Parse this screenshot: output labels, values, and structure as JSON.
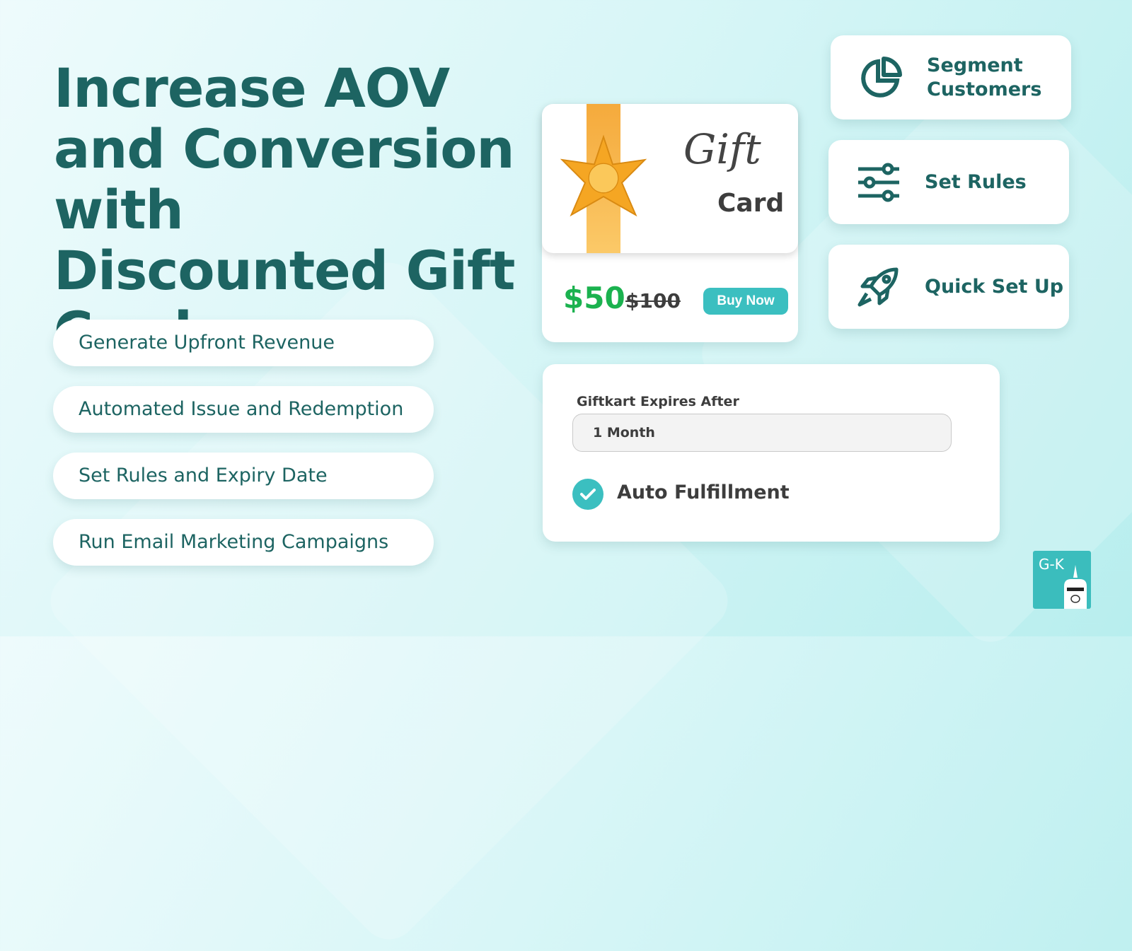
{
  "headline": "Increase AOV and Conversion with Discounted Gift Cards",
  "benefits": [
    "Generate Upfront Revenue",
    "Automated Issue and Redemption",
    "Set Rules and Expiry Date",
    "Run Email Marketing Campaigns"
  ],
  "gift_card": {
    "script_word": "Gift",
    "word": "Card",
    "price": "$50",
    "original_price": "$100",
    "buy_label": "Buy Now"
  },
  "features": [
    {
      "label": "Segment Customers",
      "icon": "pie-chart-icon"
    },
    {
      "label": "Set Rules",
      "icon": "sliders-icon"
    },
    {
      "label": "Quick Set Up",
      "icon": "rocket-icon"
    }
  ],
  "settings": {
    "expiry_label": "Giftkart Expires After",
    "expiry_value": "1 Month",
    "auto_label": "Auto Fulfillment",
    "auto_checked": true
  },
  "logo": {
    "text": "GK"
  },
  "colors": {
    "brand": "#1d6462",
    "accent": "#3bbfc0",
    "price": "#1bb24f",
    "ribbon": "#f5aa3c"
  }
}
